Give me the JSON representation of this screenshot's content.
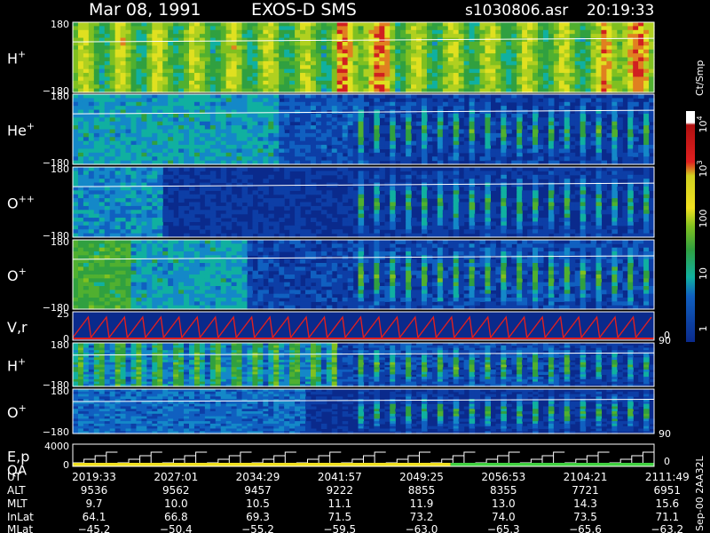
{
  "header": {
    "date": "Mar 08, 1991",
    "instrument": "EXOS-D SMS",
    "file": "s1030806.asr",
    "time": "20:19:33"
  },
  "panels": [
    {
      "id": "h-plus",
      "label_base": "H",
      "label_sup": "+",
      "ytop": "180",
      "ybot": "−180",
      "right_tick": ""
    },
    {
      "id": "he-plus",
      "label_base": "He",
      "label_sup": "+",
      "ytop": "180",
      "ybot": "−180",
      "right_tick": ""
    },
    {
      "id": "o-plusplus",
      "label_base": "O",
      "label_sup": "++",
      "ytop": "180",
      "ybot": "−180",
      "right_tick": ""
    },
    {
      "id": "o-plus",
      "label_base": "O",
      "label_sup": "+",
      "ytop": "180",
      "ybot": "−180",
      "right_tick": ""
    },
    {
      "id": "vr",
      "label_base": "V,r",
      "label_sup": "",
      "ytop": "25",
      "ybot": "0",
      "right_tick": "90",
      "right_bottom": "0"
    },
    {
      "id": "h-plus-2",
      "label_base": "H",
      "label_sup": "+",
      "ytop": "180",
      "ybot": "−180",
      "right_tick": ""
    },
    {
      "id": "o-plus-2",
      "label_base": "O",
      "label_sup": "+",
      "ytop": "180",
      "ybot": "−180",
      "right_tick": "90",
      "right_bottom": ""
    },
    {
      "id": "ep",
      "label_base": "E,p",
      "label_base2": "QA",
      "label_sup": "",
      "ytop": "4000",
      "ybot": "0",
      "right_tick": "",
      "right_bottom": "0"
    }
  ],
  "colorbar": {
    "unit": "Ct/Smp",
    "labels": [
      {
        "base": "10",
        "sup": "4"
      },
      {
        "base": "10",
        "sup": "3"
      },
      {
        "base": "100",
        "sup": ""
      },
      {
        "base": "10",
        "sup": ""
      },
      {
        "base": "1",
        "sup": ""
      }
    ]
  },
  "footer_row_labels": [
    "UT",
    "ALT",
    "MLT",
    "InLat",
    "MLat"
  ],
  "footer_columns": [
    {
      "UT": "2019:33",
      "ALT": "9536",
      "MLT": "9.7",
      "InLat": "64.1",
      "MLat": "−45.2"
    },
    {
      "UT": "2027:01",
      "ALT": "9562",
      "MLT": "10.0",
      "InLat": "66.8",
      "MLat": "−50.4"
    },
    {
      "UT": "2034:29",
      "ALT": "9457",
      "MLT": "10.5",
      "InLat": "69.3",
      "MLat": "−55.2"
    },
    {
      "UT": "2041:57",
      "ALT": "9222",
      "MLT": "11.1",
      "InLat": "71.5",
      "MLat": "−59.5"
    },
    {
      "UT": "2049:25",
      "ALT": "8855",
      "MLT": "11.9",
      "InLat": "73.2",
      "MLat": "−63.0"
    },
    {
      "UT": "2056:53",
      "ALT": "8355",
      "MLT": "13.0",
      "InLat": "74.0",
      "MLat": "−65.3"
    },
    {
      "UT": "2104:21",
      "ALT": "7721",
      "MLT": "14.3",
      "InLat": "73.5",
      "MLat": "−65.6"
    },
    {
      "UT": "2111:49",
      "ALT": "6951",
      "MLT": "15.6",
      "InLat": "71.1",
      "MLat": "−63.2"
    }
  ],
  "side_stamp": "Sep-00 2AA32L",
  "colors": {
    "bg": "#000000",
    "spectrogram_low": "#0a2a8c",
    "velocity_trace": "#e02020",
    "quality_yellow": "#f0e020",
    "quality_green": "#40d040"
  },
  "chart_data": {
    "type": "heatmap",
    "x": [
      "2019:33",
      "2027:01",
      "2034:29",
      "2041:57",
      "2049:25",
      "2056:53",
      "2104:21",
      "2111:49"
    ],
    "panels": [
      "H+",
      "He+",
      "O++",
      "O+",
      "V,r",
      "H+",
      "O+",
      "E,p"
    ],
    "pitch_range": [
      -180,
      180
    ],
    "color_scale": "log",
    "color_range": [
      1,
      10000
    ]
  }
}
